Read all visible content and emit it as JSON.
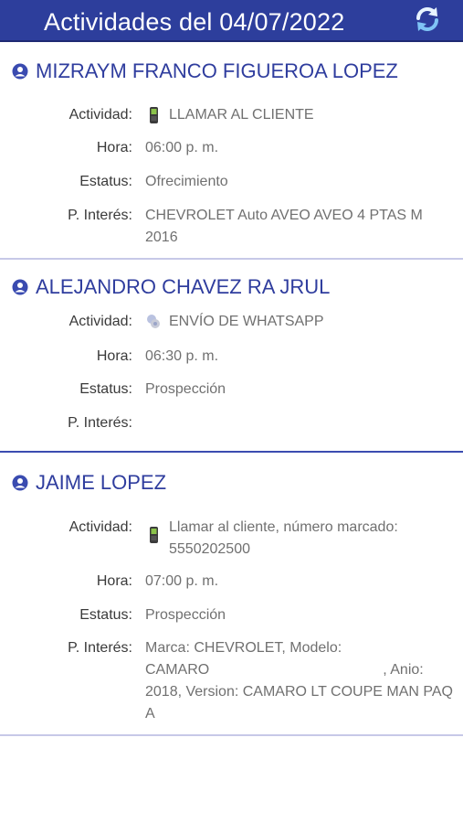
{
  "header": {
    "title": "Actividades del 04/07/2022",
    "refresh_icon": "refresh-icon",
    "bg_color": "#2d3e9c"
  },
  "labels": {
    "activity": "Actividad:",
    "hour": "Hora:",
    "status": "Estatus:",
    "interest": "P. Interés:"
  },
  "cards": [
    {
      "name": "MIZRAYM  FRANCO FIGUEROA  LOPEZ",
      "activity": "LLAMAR AL CLIENTE",
      "activity_icon": "phone-icon",
      "hour": "06:00 p. m.",
      "status": "Ofrecimiento",
      "interest_line1": "CHEVROLET Auto AVEO AVEO 4 PTAS M",
      "interest_line2": "2016"
    },
    {
      "name": "ALEJANDRO CHAVEZ  RA JRUL",
      "activity": "ENVÍO DE WHATSAPP",
      "activity_icon": "whatsapp-icon",
      "hour": "06:30 p. m.",
      "status": "Prospección",
      "interest": ""
    },
    {
      "name": "JAIME  LOPEZ",
      "activity_line1": "Llamar al cliente, número marcado:",
      "activity_line2": "5550202500",
      "activity_icon": "phone-icon",
      "hour": "07:00 p. m.",
      "status": "Prospección",
      "interest_line1": "Marca: CHEVROLET, Modelo:",
      "interest_line2a": "CAMARO",
      "interest_line2b": ", Anio:",
      "interest_line3": "2018, Version: CAMARO LT COUPE MAN PAQ",
      "interest_line4": "A"
    }
  ]
}
